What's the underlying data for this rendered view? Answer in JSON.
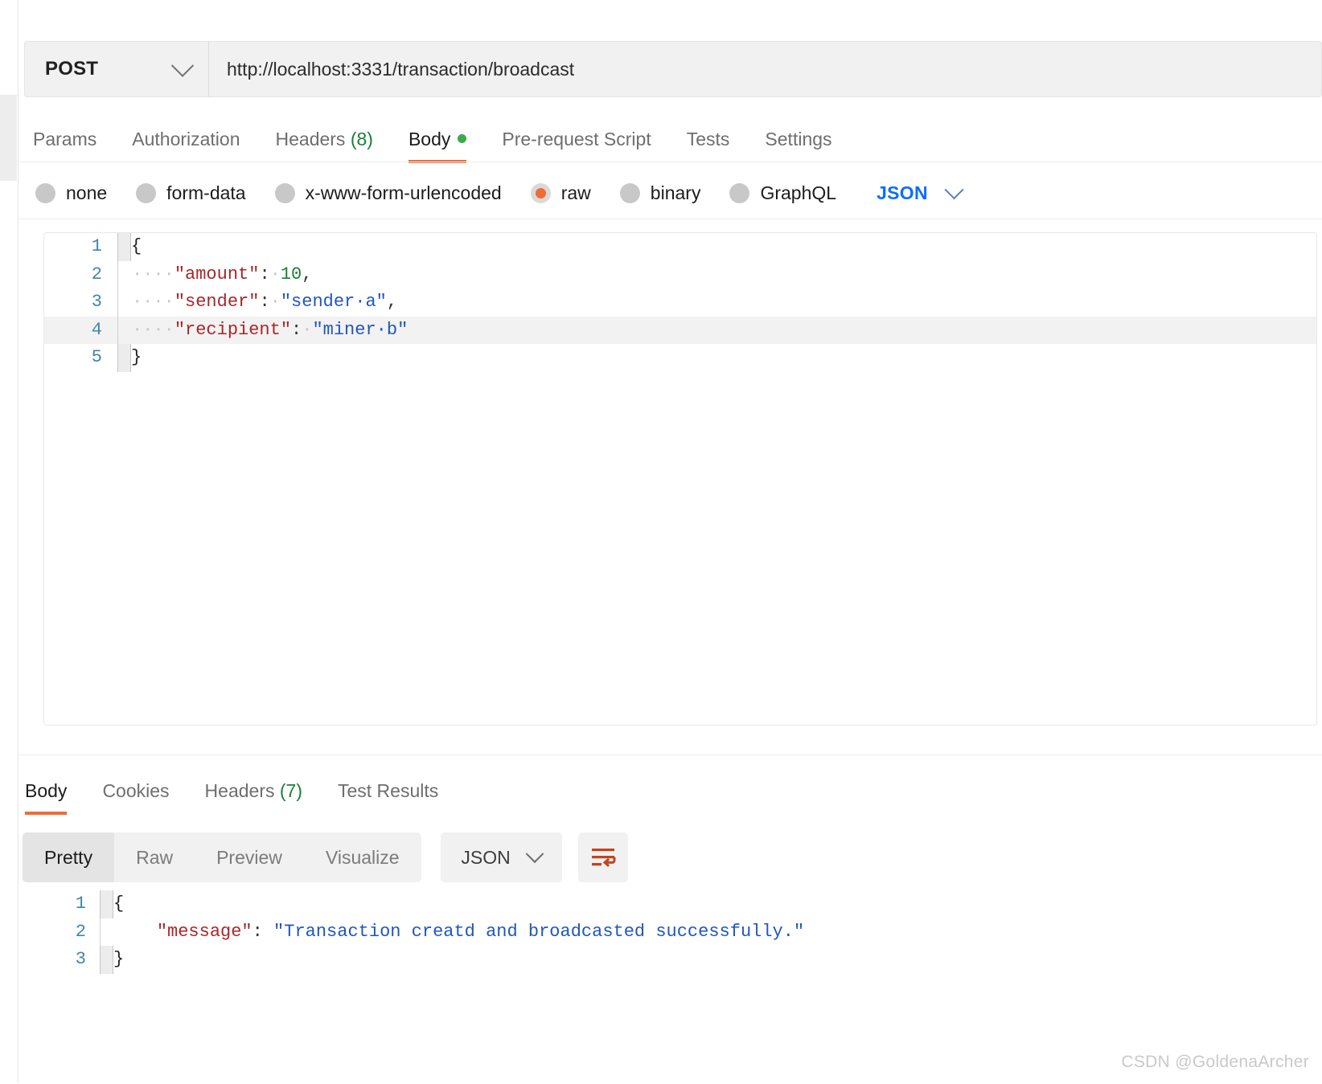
{
  "request": {
    "method": "POST",
    "url": "http://localhost:3331/transaction/broadcast",
    "tabs": [
      {
        "label": "Params",
        "active": false
      },
      {
        "label": "Authorization",
        "active": false
      },
      {
        "label": "Headers",
        "count": "(8)",
        "active": false
      },
      {
        "label": "Body",
        "active": true,
        "dot": true
      },
      {
        "label": "Pre-request Script",
        "active": false
      },
      {
        "label": "Tests",
        "active": false
      },
      {
        "label": "Settings",
        "active": false
      }
    ],
    "body_types": [
      {
        "label": "none",
        "selected": false
      },
      {
        "label": "form-data",
        "selected": false
      },
      {
        "label": "x-www-form-urlencoded",
        "selected": false
      },
      {
        "label": "raw",
        "selected": true
      },
      {
        "label": "binary",
        "selected": false
      },
      {
        "label": "GraphQL",
        "selected": false
      }
    ],
    "raw_format": "JSON",
    "body_lines": [
      {
        "num": "1",
        "brace": true,
        "active": false,
        "tokens": [
          {
            "t": "{",
            "c": "k-brace"
          }
        ]
      },
      {
        "num": "2",
        "brace": false,
        "active": false,
        "tokens": [
          {
            "t": "····",
            "c": "k-ws"
          },
          {
            "t": "\"amount\"",
            "c": "k-key"
          },
          {
            "t": ":",
            "c": "k-pun"
          },
          {
            "t": "·",
            "c": "k-ws"
          },
          {
            "t": "10",
            "c": "k-num"
          },
          {
            "t": ",",
            "c": "k-pun"
          }
        ]
      },
      {
        "num": "3",
        "brace": false,
        "active": false,
        "tokens": [
          {
            "t": "····",
            "c": "k-ws"
          },
          {
            "t": "\"sender\"",
            "c": "k-key"
          },
          {
            "t": ":",
            "c": "k-pun"
          },
          {
            "t": "·",
            "c": "k-ws"
          },
          {
            "t": "\"sender·a\"",
            "c": "k-str"
          },
          {
            "t": ",",
            "c": "k-pun"
          }
        ]
      },
      {
        "num": "4",
        "brace": false,
        "active": true,
        "tokens": [
          {
            "t": "····",
            "c": "k-ws"
          },
          {
            "t": "\"recipient\"",
            "c": "k-key"
          },
          {
            "t": ":",
            "c": "k-pun"
          },
          {
            "t": "·",
            "c": "k-ws"
          },
          {
            "t": "\"miner·b\"",
            "c": "k-str"
          }
        ]
      },
      {
        "num": "5",
        "brace": true,
        "active": false,
        "tokens": [
          {
            "t": "}",
            "c": "k-brace"
          }
        ]
      }
    ]
  },
  "response": {
    "tabs": [
      {
        "label": "Body",
        "active": true
      },
      {
        "label": "Cookies",
        "active": false
      },
      {
        "label": "Headers",
        "count": "(7)",
        "active": false
      },
      {
        "label": "Test Results",
        "active": false
      }
    ],
    "view_modes": [
      {
        "label": "Pretty",
        "active": true
      },
      {
        "label": "Raw",
        "active": false
      },
      {
        "label": "Preview",
        "active": false
      },
      {
        "label": "Visualize",
        "active": false
      }
    ],
    "format": "JSON",
    "wrap_icon": "wrap-lines-icon",
    "body_lines": [
      {
        "num": "1",
        "brace": true,
        "active": false,
        "tokens": [
          {
            "t": "{",
            "c": "k-brace"
          }
        ]
      },
      {
        "num": "2",
        "brace": false,
        "active": false,
        "tokens": [
          {
            "t": "    ",
            "c": "k-ws"
          },
          {
            "t": "\"message\"",
            "c": "k-key"
          },
          {
            "t": ": ",
            "c": "k-pun"
          },
          {
            "t": "\"Transaction creatd and broadcasted successfully.\"",
            "c": "k-str"
          }
        ]
      },
      {
        "num": "3",
        "brace": true,
        "active": false,
        "tokens": [
          {
            "t": "}",
            "c": "k-brace"
          }
        ]
      }
    ]
  },
  "watermark": "CSDN @GoldenaArcher",
  "colors": {
    "accent": "#ef6c37",
    "link": "#0d6efd",
    "green": "#1a7f37",
    "key": "#a6272a",
    "string": "#2256b8"
  }
}
